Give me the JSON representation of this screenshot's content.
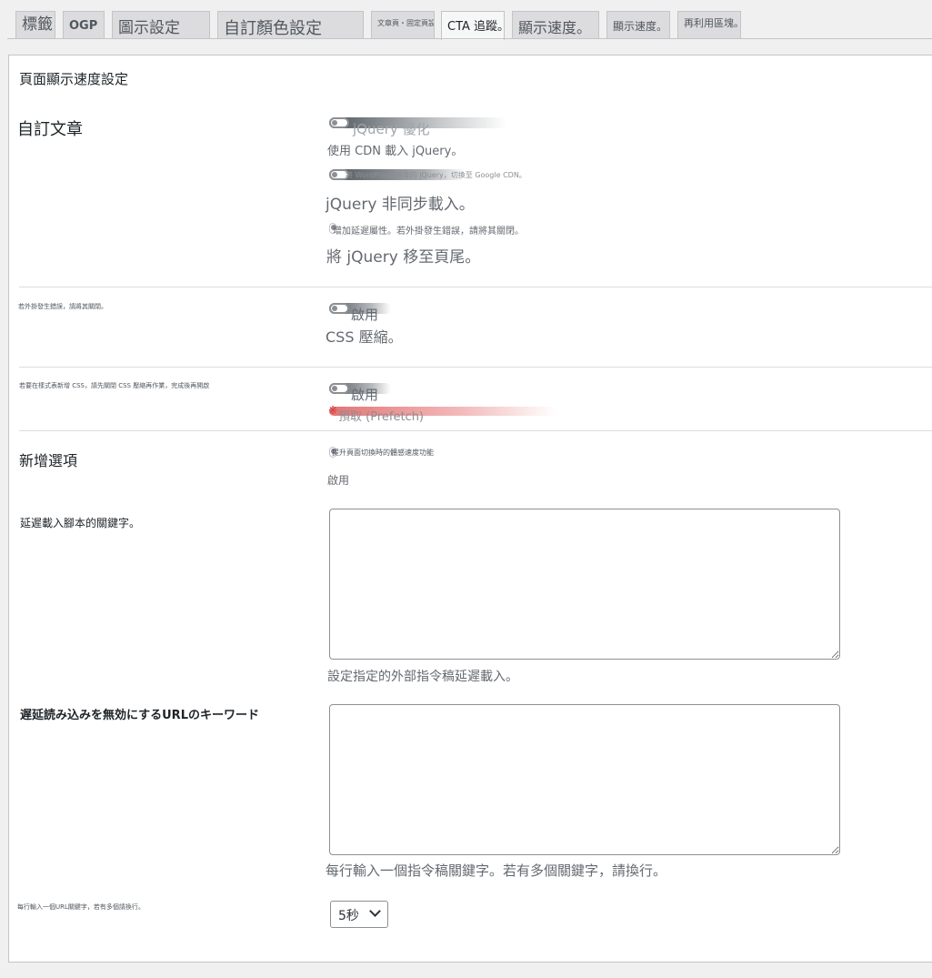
{
  "tabs": [
    {
      "label": "標籤"
    },
    {
      "label": "OGP"
    },
    {
      "label": "圖示設定"
    },
    {
      "label": "自訂顏色設定"
    },
    {
      "label": "文章頁・固定頁設定"
    },
    {
      "label": "CTA 追蹤。"
    },
    {
      "label": "顯示速度。"
    },
    {
      "label": "顯示速度。"
    },
    {
      "label": "再利用區塊。"
    }
  ],
  "panel": {
    "heading": "頁面顯示速度設定",
    "jquery": {
      "section_label": "自訂文章",
      "optimize_label": "jQuery 優化",
      "cdn_desc": "使用 CDN 載入 jQuery。",
      "cdn_sub": "將 WordPress 本身的 jQuery，切換至 Google CDN。",
      "async_label": "jQuery 非同步載入。",
      "async_desc": "增加延遲屬性。若外掛發生錯誤，請將其關閉。",
      "footer_label": "將 jQuery 移至頁尾。"
    },
    "css_minify": {
      "side_note": "若外掛發生錯誤，請將其關閉。",
      "enable": "啟用",
      "label": "CSS 壓縮。"
    },
    "prefetch": {
      "side_note": "若要在樣式表新增 CSS，請先關閉 CSS 壓縮再作業，完成後再開啟",
      "enable": "啟用",
      "mark": "※",
      "label": "預取 (Prefetch)"
    },
    "new_option": {
      "label": "新增選項",
      "desc": "提升頁面切換時的體感速度功能",
      "enable": "啟用"
    },
    "delay_keywords": {
      "label": "延遲載入腳本的關鍵字。",
      "value": "",
      "desc": "設定指定的外部指令稿延遲載入。"
    },
    "disable_delay_url": {
      "label": "遅延読み込みを無効にするURLのキーワード",
      "value": "",
      "desc": "每行輸入一個指令稿關鍵字。若有多個關鍵字，請換行。"
    },
    "timing": {
      "side_note": "每行輸入一個URL關鍵字，若有多個請換行。",
      "selected": "5秒"
    }
  },
  "colors": {
    "accent_red": "#e05a5a",
    "toggle_smear": "#50575e"
  }
}
